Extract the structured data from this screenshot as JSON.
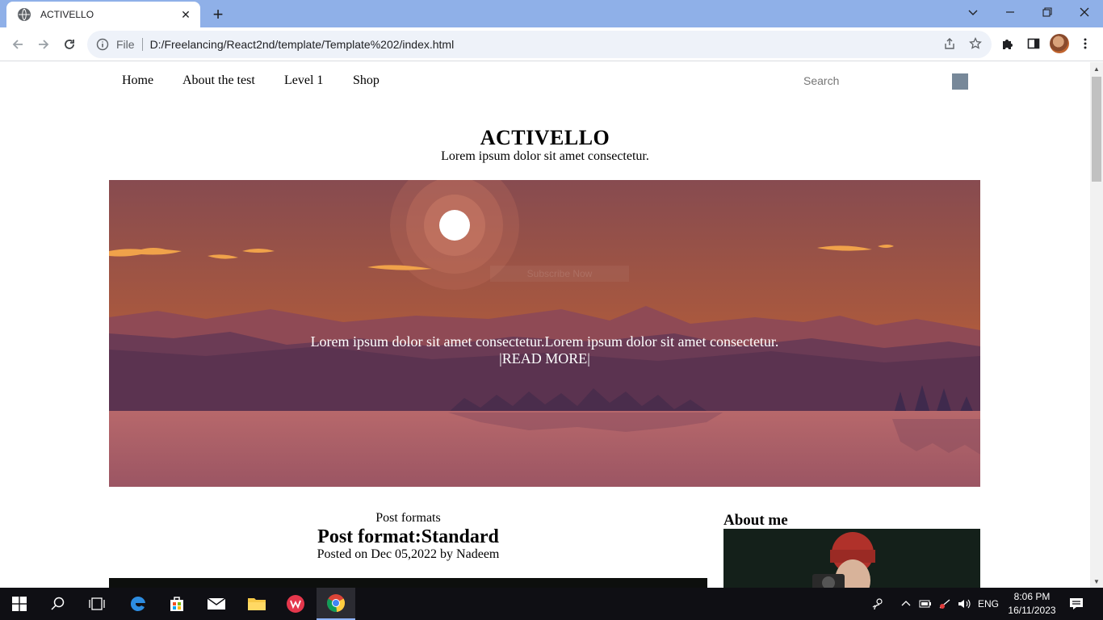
{
  "browser": {
    "tab_title": "ACTIVELLO",
    "url_scheme": "File",
    "url": "D:/Freelancing/React2nd/template/Template%202/index.html"
  },
  "site": {
    "nav": [
      "Home",
      "About the test",
      "Level 1",
      "Shop"
    ],
    "search_placeholder": "Search",
    "brand": "ACTIVELLO",
    "tagline": "Lorem ipsum dolor sit amet consectetur.",
    "hero": {
      "text": "Lorem ipsum dolor sit amet consectetur.Lorem ipsum dolor sit amet consectetur.",
      "button": "|READ MORE|",
      "faint_label": "Subscribe Now"
    },
    "post": {
      "category": "Post formats",
      "title": "Post format:Standard",
      "meta": "Posted on Dec 05,2022 by Nadeem"
    },
    "sidebar": {
      "about_title": "About me"
    }
  },
  "taskbar": {
    "language": "ENG",
    "time": "8:06 PM",
    "date": "16/11/2023"
  },
  "colors": {
    "tabbar": "#8fb0e8",
    "sky_top": "#8a5052",
    "sky_mid": "#c8653c",
    "mountains": "#5b3350",
    "water": "#a85e63"
  }
}
